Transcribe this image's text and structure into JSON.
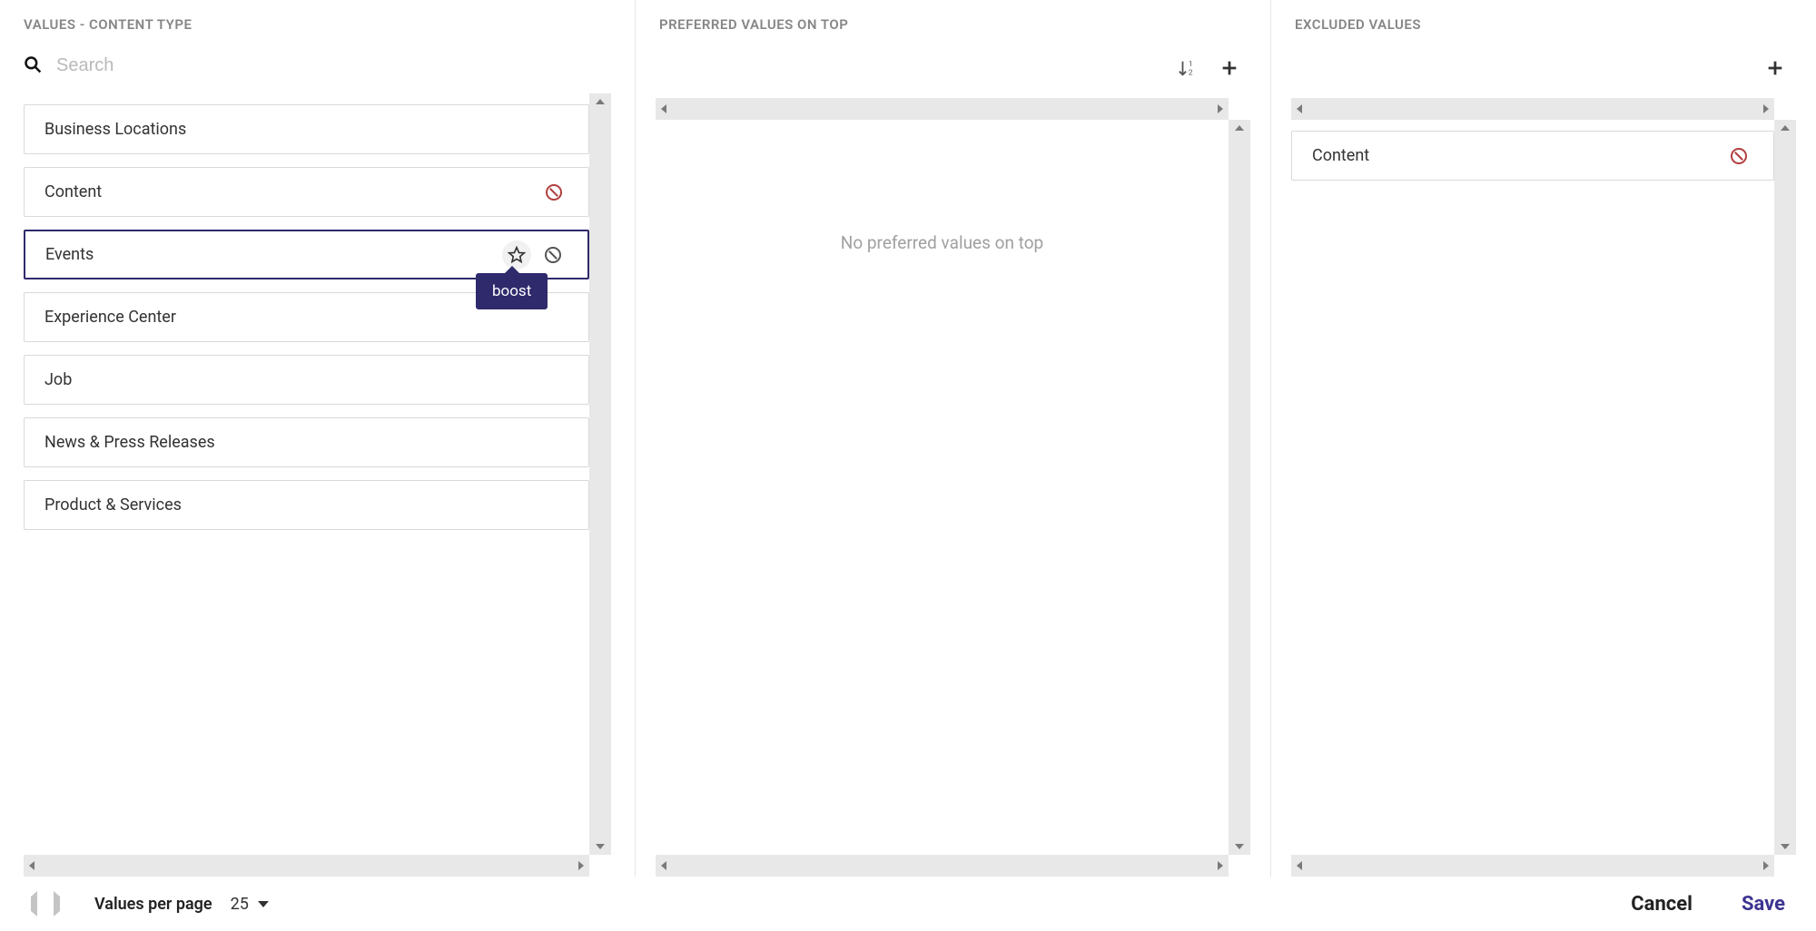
{
  "columns": {
    "values": {
      "title": "VALUES - CONTENT TYPE",
      "search_placeholder": "Search",
      "items": [
        {
          "label": "Business Locations",
          "excluded": false,
          "hover": false
        },
        {
          "label": "Content",
          "excluded": true,
          "hover": false
        },
        {
          "label": "Events",
          "excluded": false,
          "hover": true
        },
        {
          "label": "Experience Center",
          "excluded": false,
          "hover": false
        },
        {
          "label": "Job",
          "excluded": false,
          "hover": false
        },
        {
          "label": "News & Press Releases",
          "excluded": false,
          "hover": false
        },
        {
          "label": "Product & Services",
          "excluded": false,
          "hover": false
        }
      ],
      "tooltip": "boost"
    },
    "preferred": {
      "title": "PREFERRED VALUES ON TOP",
      "empty_message": "No preferred values on top"
    },
    "excluded": {
      "title": "EXCLUDED VALUES",
      "items": [
        {
          "label": "Content"
        }
      ]
    }
  },
  "footer": {
    "values_per_page_label": "Values per page",
    "values_per_page_value": "25",
    "cancel": "Cancel",
    "save": "Save"
  }
}
